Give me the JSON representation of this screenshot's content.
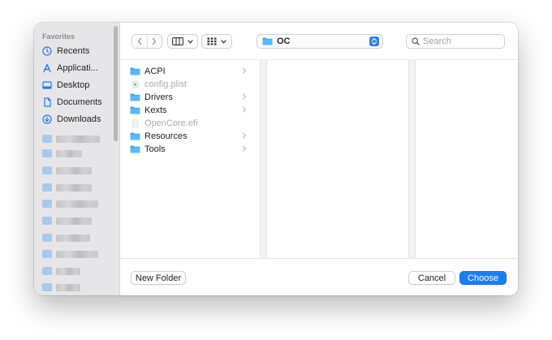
{
  "sidebar": {
    "section": "Favorites",
    "items": [
      {
        "label": "Recents",
        "icon": "clock-icon"
      },
      {
        "label": "Applicati...",
        "icon": "applications-icon"
      },
      {
        "label": "Desktop",
        "icon": "desktop-icon"
      },
      {
        "label": "Documents",
        "icon": "document-icon"
      },
      {
        "label": "Downloads",
        "icon": "download-icon"
      }
    ]
  },
  "toolbar": {
    "path": "OC",
    "search_placeholder": "Search"
  },
  "files": [
    {
      "name": "ACPI",
      "kind": "folder",
      "has_children": true,
      "enabled": true
    },
    {
      "name": "config.plist",
      "kind": "file",
      "has_children": false,
      "enabled": false
    },
    {
      "name": "Drivers",
      "kind": "folder",
      "has_children": true,
      "enabled": true
    },
    {
      "name": "Kexts",
      "kind": "folder",
      "has_children": true,
      "enabled": true
    },
    {
      "name": "OpenCore.efi",
      "kind": "file",
      "has_children": false,
      "enabled": false
    },
    {
      "name": "Resources",
      "kind": "folder",
      "has_children": true,
      "enabled": true
    },
    {
      "name": "Tools",
      "kind": "folder",
      "has_children": true,
      "enabled": true
    }
  ],
  "footer": {
    "new_folder_label": "New Folder",
    "cancel_label": "Cancel",
    "choose_label": "Choose"
  },
  "colors": {
    "accent": "#1a7df5",
    "folder": "#3fa6f2",
    "sidebar_bg": "#e6e6e8"
  }
}
